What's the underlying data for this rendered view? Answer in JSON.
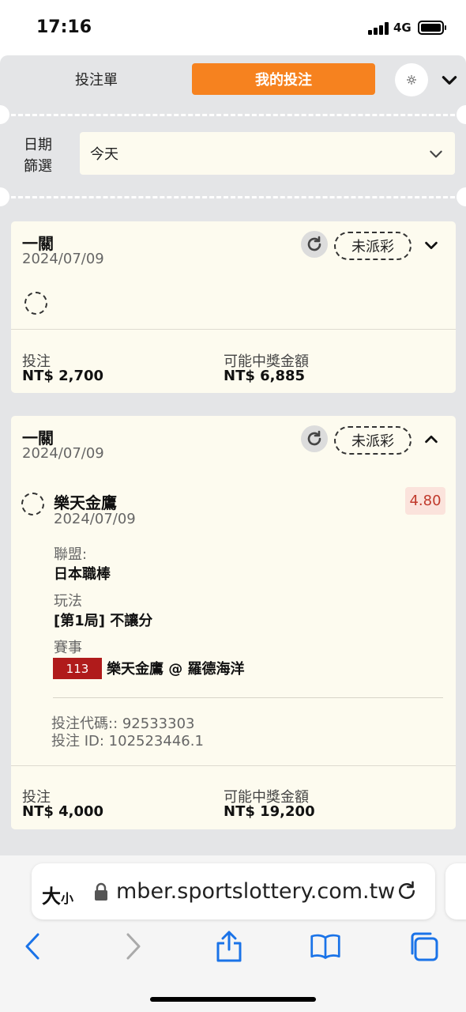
{
  "status_bar": {
    "time": "17:16",
    "network": "4G"
  },
  "tabs": {
    "bet_slip": "投注單",
    "my_bets": "我的投注"
  },
  "filter": {
    "label_line1": "日期",
    "label_line2": "篩選",
    "selected": "今天"
  },
  "cards": [
    {
      "title": "一關",
      "date": "2024/07/09",
      "status": "未派彩",
      "stake_label": "投注",
      "stake_value": "NT$ 2,700",
      "payout_label": "可能中獎金額",
      "payout_value": "NT$ 6,885"
    },
    {
      "title": "一關",
      "date": "2024/07/09",
      "status": "未派彩",
      "selection": {
        "team": "樂天金鷹",
        "date": "2024/07/09",
        "odds": "4.80",
        "league_label": "聯盟:",
        "league_value": "日本職棒",
        "market_label": "玩法",
        "market_value": "[第1局] 不讓分",
        "event_label": "賽事",
        "event_id": "113",
        "event_name": "樂天金鷹 @ 羅德海洋"
      },
      "bet_code": "投注代碼:: 92533303",
      "bet_id": "投注 ID: 102523446.1",
      "stake_label": "投注",
      "stake_value": "NT$ 4,000",
      "payout_label": "可能中獎金額",
      "payout_value": "NT$ 19,200"
    }
  ],
  "browser": {
    "text_size_big": "大",
    "text_size_small": "小",
    "url": "mber.sportslottery.com.tw"
  },
  "colors": {
    "accent": "#f6821f",
    "odds": "#c0392b",
    "event_badge": "#b01b1b",
    "card_bg": "#fdfbef"
  }
}
